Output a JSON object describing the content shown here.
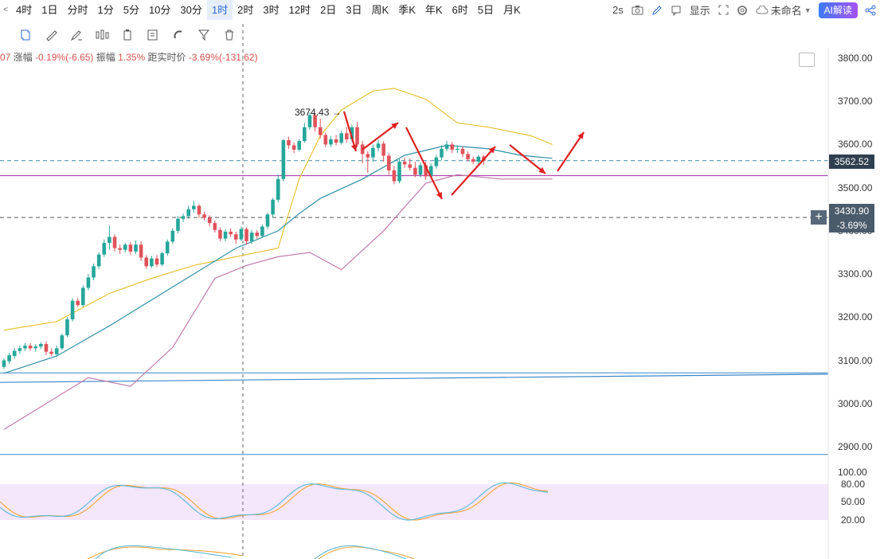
{
  "timeframes": [
    "4时",
    "1日",
    "分时",
    "1分",
    "5分",
    "10分",
    "30分",
    "1时",
    "2时",
    "3时",
    "12时",
    "2日",
    "3日",
    "周K",
    "季K",
    "年K",
    "6时",
    "5日",
    "月K"
  ],
  "active_timeframe": "1时",
  "top_right": {
    "refresh": "2s",
    "display": "显示",
    "name": "未命名",
    "ai": "AI解读"
  },
  "info": {
    "prefix": "07",
    "change_label": "涨幅",
    "change_value": "-0.19%(-6.65)",
    "amp_label": "振幅",
    "amp_value": "1.35%",
    "dist_label": "距实时价",
    "dist_value": "-3.69%(-131.62)"
  },
  "annotation": "3674.43",
  "current_price": "3562.52",
  "cursor_price": "3430.90",
  "cursor_pct": "-3.69%",
  "colors": {
    "up": "#26a69a",
    "down": "#e0525a",
    "upper_band": "#e8c23a",
    "mid_band": "#2f8fa6",
    "lower_band": "#c27aa8",
    "arrow": "#e02020",
    "purple_line": "#b04ab0",
    "blue_line": "#3a86c8"
  },
  "chart_data": {
    "type": "candlestick",
    "price_axis": {
      "ticks": [
        "3800.00",
        "3700.00",
        "3600.00",
        "3500.00",
        "3400.00",
        "3300.00",
        "3200.00",
        "3100.00",
        "3000.00",
        "2900.00"
      ],
      "range": [
        2870,
        3820
      ]
    },
    "oscillator_axis": {
      "ticks": [
        "100.00",
        "80.00",
        "50.00",
        "20.00"
      ]
    },
    "candles": [
      [
        3085,
        3100,
        3080,
        3105
      ],
      [
        3098,
        3112,
        3092,
        3118
      ],
      [
        3110,
        3122,
        3104,
        3128
      ],
      [
        3122,
        3128,
        3115,
        3134
      ],
      [
        3128,
        3134,
        3122,
        3140
      ],
      [
        3134,
        3128,
        3122,
        3140
      ],
      [
        3128,
        3132,
        3120,
        3138
      ],
      [
        3132,
        3138,
        3126,
        3142
      ],
      [
        3138,
        3120,
        3112,
        3144
      ],
      [
        3120,
        3115,
        3110,
        3128
      ],
      [
        3114,
        3128,
        3110,
        3134
      ],
      [
        3128,
        3158,
        3124,
        3162
      ],
      [
        3158,
        3195,
        3154,
        3200
      ],
      [
        3195,
        3238,
        3190,
        3244
      ],
      [
        3238,
        3228,
        3224,
        3244
      ],
      [
        3228,
        3268,
        3224,
        3274
      ],
      [
        3268,
        3292,
        3262,
        3300
      ],
      [
        3292,
        3318,
        3286,
        3324
      ],
      [
        3318,
        3345,
        3312,
        3350
      ],
      [
        3345,
        3372,
        3340,
        3380
      ],
      [
        3372,
        3386,
        3356,
        3412
      ],
      [
        3386,
        3360,
        3352,
        3392
      ],
      [
        3360,
        3356,
        3346,
        3368
      ],
      [
        3356,
        3368,
        3350,
        3372
      ],
      [
        3368,
        3352,
        3344,
        3374
      ],
      [
        3352,
        3368,
        3346,
        3378
      ],
      [
        3368,
        3338,
        3330,
        3376
      ],
      [
        3338,
        3318,
        3312,
        3344
      ],
      [
        3318,
        3336,
        3314,
        3342
      ],
      [
        3336,
        3322,
        3316,
        3344
      ],
      [
        3322,
        3348,
        3318,
        3352
      ],
      [
        3348,
        3375,
        3342,
        3380
      ],
      [
        3375,
        3400,
        3370,
        3406
      ],
      [
        3400,
        3428,
        3394,
        3434
      ],
      [
        3428,
        3434,
        3420,
        3440
      ],
      [
        3434,
        3450,
        3428,
        3458
      ],
      [
        3450,
        3458,
        3442,
        3470
      ],
      [
        3458,
        3438,
        3430,
        3462
      ],
      [
        3438,
        3430,
        3424,
        3444
      ],
      [
        3430,
        3418,
        3410,
        3436
      ],
      [
        3418,
        3402,
        3396,
        3424
      ],
      [
        3402,
        3382,
        3376,
        3408
      ],
      [
        3382,
        3398,
        3376,
        3404
      ],
      [
        3398,
        3392,
        3386,
        3406
      ],
      [
        3392,
        3380,
        3370,
        3398
      ],
      [
        3380,
        3404,
        3376,
        3410
      ],
      [
        3404,
        3376,
        3368,
        3408
      ],
      [
        3376,
        3396,
        3370,
        3402
      ],
      [
        3396,
        3388,
        3382,
        3402
      ],
      [
        3388,
        3410,
        3384,
        3414
      ],
      [
        3410,
        3438,
        3404,
        3442
      ],
      [
        3438,
        3472,
        3432,
        3476
      ],
      [
        3472,
        3520,
        3466,
        3530
      ],
      [
        3520,
        3610,
        3514,
        3612
      ],
      [
        3610,
        3598,
        3590,
        3618
      ],
      [
        3598,
        3588,
        3580,
        3605
      ],
      [
        3588,
        3608,
        3584,
        3612
      ],
      [
        3608,
        3640,
        3604,
        3650
      ],
      [
        3640,
        3668,
        3634,
        3674
      ],
      [
        3668,
        3640,
        3630,
        3672
      ],
      [
        3640,
        3622,
        3614,
        3660
      ],
      [
        3622,
        3600,
        3594,
        3628
      ],
      [
        3600,
        3612,
        3594,
        3620
      ],
      [
        3612,
        3604,
        3598,
        3622
      ],
      [
        3604,
        3626,
        3600,
        3632
      ],
      [
        3626,
        3612,
        3604,
        3640
      ],
      [
        3612,
        3640,
        3606,
        3646
      ],
      [
        3640,
        3600,
        3594,
        3652
      ],
      [
        3600,
        3578,
        3556,
        3608
      ],
      [
        3578,
        3570,
        3534,
        3584
      ],
      [
        3570,
        3592,
        3560,
        3600
      ],
      [
        3592,
        3602,
        3584,
        3610
      ],
      [
        3602,
        3574,
        3560,
        3608
      ],
      [
        3574,
        3540,
        3530,
        3580
      ],
      [
        3540,
        3515,
        3508,
        3550
      ],
      [
        3515,
        3560,
        3510,
        3566
      ],
      [
        3560,
        3554,
        3546,
        3570
      ],
      [
        3554,
        3546,
        3540,
        3568
      ],
      [
        3546,
        3530,
        3524,
        3560
      ],
      [
        3530,
        3552,
        3524,
        3558
      ],
      [
        3552,
        3526,
        3518,
        3560
      ],
      [
        3526,
        3550,
        3520,
        3556
      ],
      [
        3550,
        3570,
        3544,
        3576
      ],
      [
        3570,
        3590,
        3564,
        3598
      ],
      [
        3590,
        3600,
        3584,
        3608
      ],
      [
        3600,
        3588,
        3580,
        3606
      ],
      [
        3588,
        3590,
        3580,
        3598
      ],
      [
        3590,
        3578,
        3570,
        3596
      ],
      [
        3578,
        3566,
        3560,
        3584
      ],
      [
        3566,
        3560,
        3554,
        3572
      ],
      [
        3560,
        3572,
        3554,
        3576
      ],
      [
        3572,
        3562,
        3552,
        3576
      ]
    ],
    "upper_band": [
      [
        0,
        3170
      ],
      [
        10,
        3190
      ],
      [
        20,
        3255
      ],
      [
        28,
        3290
      ],
      [
        36,
        3320
      ],
      [
        44,
        3340
      ],
      [
        52,
        3360
      ],
      [
        56,
        3520
      ],
      [
        60,
        3620
      ],
      [
        64,
        3680
      ],
      [
        70,
        3724
      ],
      [
        74,
        3730
      ],
      [
        80,
        3705
      ],
      [
        86,
        3650
      ],
      [
        92,
        3640
      ],
      [
        100,
        3620
      ],
      [
        104,
        3600
      ]
    ],
    "mid_band": [
      [
        0,
        3070
      ],
      [
        10,
        3110
      ],
      [
        20,
        3180
      ],
      [
        28,
        3240
      ],
      [
        36,
        3300
      ],
      [
        44,
        3360
      ],
      [
        52,
        3400
      ],
      [
        56,
        3440
      ],
      [
        60,
        3475
      ],
      [
        68,
        3520
      ],
      [
        76,
        3575
      ],
      [
        84,
        3598
      ],
      [
        92,
        3590
      ],
      [
        98,
        3575
      ],
      [
        104,
        3568
      ]
    ],
    "lower_band": [
      [
        0,
        2940
      ],
      [
        8,
        3000
      ],
      [
        16,
        3060
      ],
      [
        24,
        3040
      ],
      [
        32,
        3130
      ],
      [
        40,
        3290
      ],
      [
        46,
        3320
      ],
      [
        52,
        3340
      ],
      [
        58,
        3350
      ],
      [
        64,
        3310
      ],
      [
        72,
        3400
      ],
      [
        80,
        3510
      ],
      [
        86,
        3530
      ],
      [
        94,
        3520
      ],
      [
        104,
        3520
      ]
    ]
  }
}
